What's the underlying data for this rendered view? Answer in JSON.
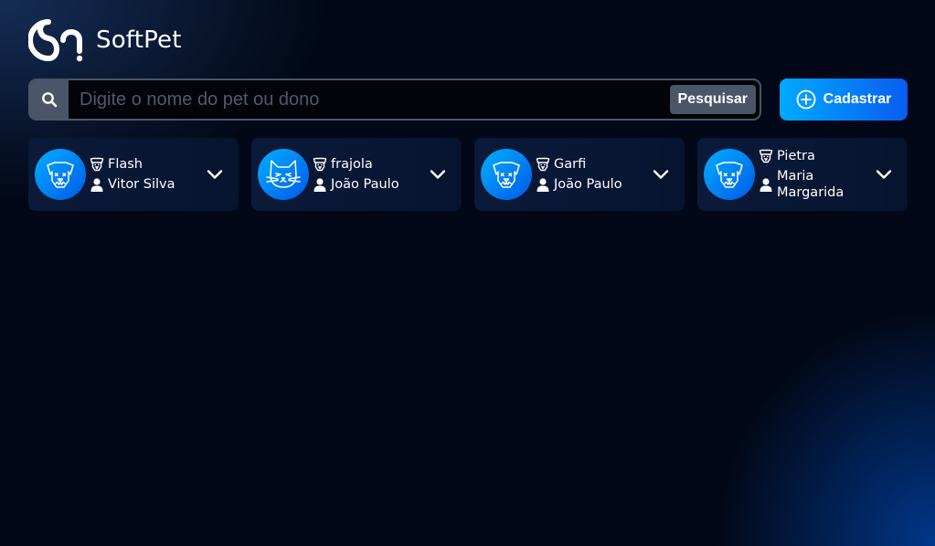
{
  "app": {
    "name": "SoftPet",
    "logo_icon": "softpet-logo-icon"
  },
  "search": {
    "placeholder": "Digite o nome do pet ou dono",
    "value": "",
    "button_label": "Pesquisar",
    "icon": "search-icon"
  },
  "register": {
    "label": "Cadastrar",
    "icon": "plus-circle-icon"
  },
  "colors": {
    "background": "#020817",
    "accent_start": "#00aaff",
    "accent_end": "#0a5cf0",
    "search_gray": "#4a5568"
  },
  "pets": [
    {
      "name": "Flash",
      "owner": "Vitor Silva",
      "species_icon": "dog-icon"
    },
    {
      "name": "frajola",
      "owner": "João Paulo",
      "species_icon": "cat-icon"
    },
    {
      "name": "Garfi",
      "owner": "João Paulo",
      "species_icon": "dog-icon"
    },
    {
      "name": "Pietra",
      "owner": "Maria Margarida",
      "species_icon": "dog-icon"
    }
  ]
}
